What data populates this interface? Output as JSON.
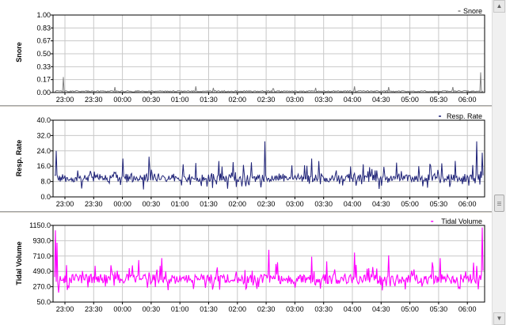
{
  "chart_data": [
    {
      "type": "line",
      "ylabel": "Snore",
      "legend": "Snore",
      "legend_position": "top-right",
      "ylim": [
        0,
        1.0
      ],
      "yticks": [
        "1.00",
        "0.83",
        "0.67",
        "0.50",
        "0.33",
        "0.17",
        "0.00"
      ],
      "xticks": [
        "23:00",
        "23:30",
        "00:00",
        "00:30",
        "01:00",
        "01:30",
        "02:00",
        "02:30",
        "03:00",
        "03:30",
        "04:00",
        "04:30",
        "05:00",
        "05:30",
        "06:00"
      ],
      "color": "#808080",
      "grid": true,
      "baseline": 0.02,
      "noise": 0.015,
      "spikes": [
        [
          0.02,
          0.2
        ],
        [
          0.14,
          0.07
        ],
        [
          0.33,
          0.08
        ],
        [
          0.37,
          0.06
        ],
        [
          0.51,
          0.05
        ],
        [
          0.61,
          0.06
        ],
        [
          0.7,
          0.08
        ],
        [
          0.78,
          0.07
        ],
        [
          0.93,
          0.07
        ],
        [
          0.995,
          0.26
        ]
      ]
    },
    {
      "type": "line",
      "ylabel": "Resp. Rate",
      "legend": "Resp. Rate",
      "legend_position": "top-right",
      "ylim": [
        0,
        40.0
      ],
      "yticks": [
        "40.0",
        "32.0",
        "24.0",
        "16.0",
        "8.0",
        "0.0"
      ],
      "xticks": [
        "23:00",
        "23:30",
        "00:00",
        "00:30",
        "01:00",
        "01:30",
        "02:00",
        "02:30",
        "03:00",
        "03:30",
        "04:00",
        "04:30",
        "05:00",
        "05:30",
        "06:00"
      ],
      "color": "#1f2378",
      "grid": true,
      "baseline": 10,
      "noise": 2.2,
      "spikes": [
        [
          0.003,
          24
        ],
        [
          0.16,
          20
        ],
        [
          0.22,
          21
        ],
        [
          0.3,
          17
        ],
        [
          0.46,
          18
        ],
        [
          0.49,
          29
        ],
        [
          0.6,
          20
        ],
        [
          0.72,
          17
        ],
        [
          0.85,
          16
        ],
        [
          0.985,
          29
        ],
        [
          0.998,
          23
        ]
      ]
    },
    {
      "type": "line",
      "ylabel": "Tidal Volume",
      "legend": "Tidal Volume",
      "legend_position": "top-right",
      "ylim": [
        50,
        1150
      ],
      "yticks": [
        "1150.0",
        "930.0",
        "710.0",
        "490.0",
        "270.0",
        "50.0"
      ],
      "xticks": [
        "23:00",
        "23:30",
        "00:00",
        "00:30",
        "01:00",
        "01:30",
        "02:00",
        "02:30",
        "03:00",
        "03:30",
        "04:00",
        "04:30",
        "05:00",
        "05:30",
        "06:00"
      ],
      "color": "#ff00ff",
      "grid": true,
      "baseline": 380,
      "noise": 70,
      "spikes": [
        [
          0.002,
          1080
        ],
        [
          0.005,
          900
        ],
        [
          0.25,
          680
        ],
        [
          0.5,
          800
        ],
        [
          0.52,
          620
        ],
        [
          0.6,
          700
        ],
        [
          0.7,
          760
        ],
        [
          0.78,
          720
        ],
        [
          0.9,
          680
        ],
        [
          0.998,
          1120
        ]
      ]
    }
  ]
}
